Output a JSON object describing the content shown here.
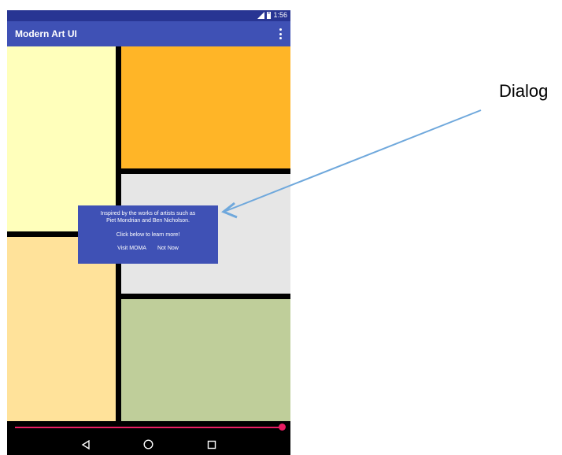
{
  "status_bar": {
    "time": "1:56",
    "signal_icon": "signal-icon",
    "battery_icon": "battery-icon"
  },
  "toolbar": {
    "title": "Modern Art UI",
    "menu_icon": "overflow-menu-icon"
  },
  "panels": [
    {
      "name": "panel-light-yellow",
      "color": "#ffffbb"
    },
    {
      "name": "panel-orange",
      "color": "#ffb527"
    },
    {
      "name": "panel-light-gray",
      "color": "#e6e6e6"
    },
    {
      "name": "panel-tan",
      "color": "#ffe29a"
    },
    {
      "name": "panel-green",
      "color": "#bfce9a"
    }
  ],
  "slider": {
    "value": 1.0,
    "color": "#e91e63"
  },
  "dialog": {
    "message_line1": "Inspired by the works of artists such as",
    "message_line2": "Piet Mondrian and Ben Nicholson.",
    "message_line3": "Click below to learn more!",
    "positive_button": "Visit MOMA",
    "negative_button": "Not Now"
  },
  "annotation": {
    "label": "Dialog",
    "arrow_color": "#6fa8dc"
  },
  "navbar": {
    "back_icon": "back-triangle-icon",
    "home_icon": "home-circle-icon",
    "recents_icon": "recents-square-icon"
  }
}
